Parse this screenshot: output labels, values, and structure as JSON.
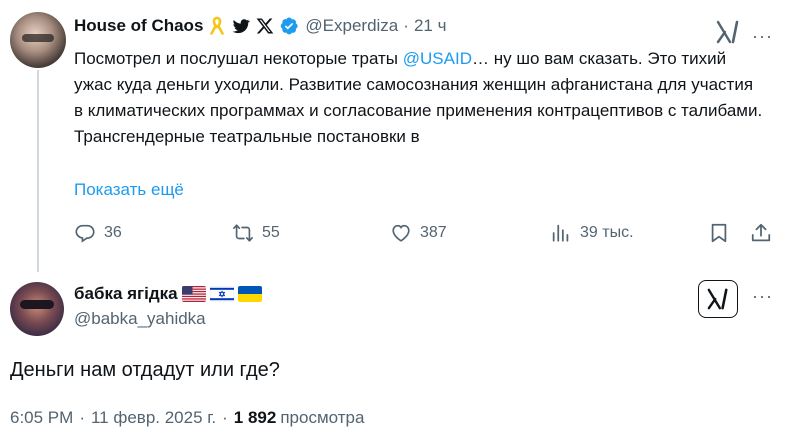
{
  "parent": {
    "display_name": "House of Chaos",
    "handle": "@Experdiza",
    "separator": "·",
    "time": "21 ч",
    "text_before_mention": "Посмотрел и послушал некоторые траты ",
    "mention": "@USAID",
    "text_after_mention": "… ну шо вам сказать. Это тихий ужас куда деньги уходили. Развитие самосознания женщин афганистана для участия в климатических программах и согласование применения контрацептивов с талибами. Трансгендерные театральные постановки в",
    "show_more": "Показать ещё",
    "badges": [
      "yellow-ribbon-icon",
      "twitter-bird-icon",
      "x-logo-icon",
      "verified-icon"
    ],
    "more": "···",
    "actions": {
      "replies": "36",
      "reposts": "55",
      "likes": "387",
      "views": "39 тыс."
    }
  },
  "reply": {
    "display_name": "бабка ягідка",
    "flags": [
      "us-flag",
      "israel-flag",
      "ukraine-flag"
    ],
    "handle": "@babka_yahidka",
    "more": "···",
    "text": "Деньги нам отдадут или где?",
    "time": "6:05 PM",
    "sep": "·",
    "date": "11 февр. 2025 г.",
    "views_count": "1 892",
    "views_label": "просмотра"
  },
  "colors": {
    "link": "#1d9bf0",
    "secondary": "#536471",
    "primary": "#0f1419",
    "verified": "#1d9bf0"
  }
}
